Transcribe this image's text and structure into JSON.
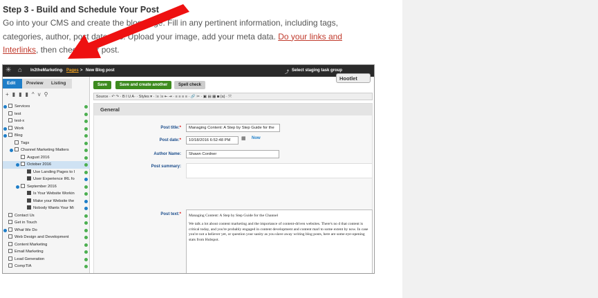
{
  "article": {
    "step_title": "Step 3 - Build and Schedule Your Post",
    "para_text": "Go into your CMS and create the blog page.  Fill in any pertinent information, including tags, categories, author, post date, etc.  Upload your image, add your meta data.",
    "para_link": "Do your links and Interlinks",
    "para_tail": ", then check your post."
  },
  "cms": {
    "breadcrumb_site": "In2theMarketing",
    "breadcrumb_pages": "Pages",
    "breadcrumb_sep": ">",
    "breadcrumb_page": "New Blog post",
    "staging": "Select staging task group",
    "hootlet": "Hootlet",
    "side_tabs": [
      "Edit",
      "Preview",
      "Listing"
    ],
    "tree": [
      {
        "label": "Services",
        "indent": 0,
        "exp": true,
        "dot": "g"
      },
      {
        "label": "test",
        "indent": 0,
        "dot": "g"
      },
      {
        "label": "test-x",
        "indent": 0,
        "dot": "g"
      },
      {
        "label": "Work",
        "indent": 0,
        "exp": true,
        "dot": "g"
      },
      {
        "label": "Blog",
        "indent": 0,
        "exp": true,
        "dot": "g"
      },
      {
        "label": "Tags",
        "indent": 1,
        "dot": "g"
      },
      {
        "label": "Channel Marketing Matters",
        "indent": 1,
        "exp": true,
        "dot": "g"
      },
      {
        "label": "August 2016",
        "indent": 2,
        "dot": "g"
      },
      {
        "label": "October 2016",
        "indent": 2,
        "exp": true,
        "dot": "g",
        "sel": true
      },
      {
        "label": "Use Landing Pages to I",
        "indent": 3,
        "dot": "g",
        "dark": true
      },
      {
        "label": "User Experience IRL fo",
        "indent": 3,
        "dot": "b",
        "dark": true
      },
      {
        "label": "September 2016",
        "indent": 2,
        "exp": true,
        "dot": "g"
      },
      {
        "label": "Is Your Website Workin",
        "indent": 3,
        "dot": "g",
        "dark": true
      },
      {
        "label": "Make your Website the",
        "indent": 3,
        "dot": "b",
        "dark": true
      },
      {
        "label": "Nobody Wants Your Mi",
        "indent": 3,
        "dot": "b",
        "dark": true
      },
      {
        "label": "Contact Us",
        "indent": 0,
        "dot": "g"
      },
      {
        "label": "Get in Touch",
        "indent": 0,
        "dot": "g"
      },
      {
        "label": "What We Do",
        "indent": 0,
        "exp": true,
        "dot": "g"
      },
      {
        "label": "Web Design and Development",
        "indent": 0,
        "dot": "g"
      },
      {
        "label": "Content Marketing",
        "indent": 0,
        "dot": "g"
      },
      {
        "label": "Email Marketing",
        "indent": 0,
        "dot": "g"
      },
      {
        "label": "Lead Generation",
        "indent": 0,
        "dot": "g"
      },
      {
        "label": "CompTIA",
        "indent": 0,
        "dot": "g"
      }
    ],
    "buttons": {
      "save": "Save",
      "save_create": "Save and create another",
      "spell": "Spell check"
    },
    "editor_bar": "Source  ·  ↶ ↷  ·  B  I  U  A·  ·  Styles ▾  ·  ⁝≡ ⁝≡ ⇤ ⇥  ·  ≡ ≡ ≡ ≡  ·  🔗 ✂  ·  ▣ ▤ ▦ ◙ {a} ·  ⤧",
    "section": "General",
    "labels": {
      "post_title": "Post title:",
      "post_date": "Post date:",
      "author": "Author Name:",
      "summary": "Post summary:",
      "post_text": "Post text:"
    },
    "values": {
      "post_title": "Managing Content: A Step by Step Guide for the",
      "post_date": "10/18/2016 6:52:48 PM",
      "now": "Now",
      "author": "Shawn Cordner"
    },
    "rte": {
      "p1": "Managing Content: A Step by Step Guide for the Channel",
      "p2": "We talk a lot about content marketing and the importance of content-driven websites.  There's no d that content is critical today, and you're probably engaged in content development and content marl to some extent by now.  In case you're not a believer yet, or question your sanity as you slave away writing blog posts, here are some eye-opening stats from Hubspot."
    }
  },
  "colors": {
    "accent": "#1e7ec8",
    "green": "#3d8b1f",
    "link": "#c0392b",
    "arrow": "#ee1111"
  }
}
